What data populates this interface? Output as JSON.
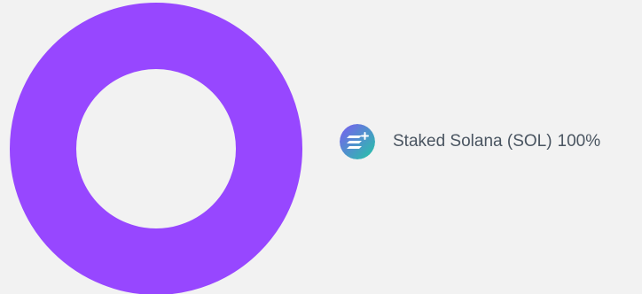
{
  "chart_data": {
    "type": "pie",
    "categories": [
      "Staked Solana (SOL)"
    ],
    "values": [
      100
    ],
    "labels": [
      "100%"
    ],
    "donut": true,
    "legend_position": "right",
    "colors": [
      "#9747ff"
    ]
  },
  "legend": {
    "items": [
      {
        "name": "Staked Solana (SOL)",
        "percent": "100%",
        "icon": "staked-solana-icon"
      }
    ]
  },
  "colors": {
    "background": "#f2f2f2",
    "slice": "#9747ff",
    "icon_gradient_start": "#7b5cf2",
    "icon_gradient_end": "#23c7a5",
    "text": "#4a5561"
  }
}
